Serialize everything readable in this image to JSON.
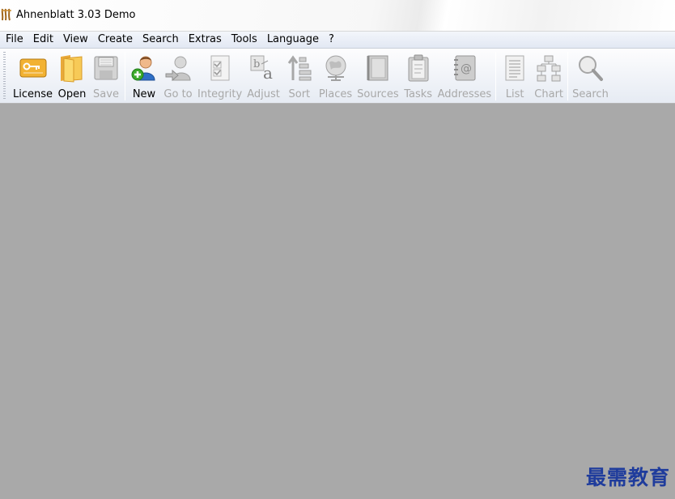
{
  "window": {
    "title": "Ahnenblatt 3.03 Demo"
  },
  "menu": {
    "items": [
      {
        "label": "File"
      },
      {
        "label": "Edit"
      },
      {
        "label": "View"
      },
      {
        "label": "Create"
      },
      {
        "label": "Search"
      },
      {
        "label": "Extras"
      },
      {
        "label": "Tools"
      },
      {
        "label": "Language"
      },
      {
        "label": "?"
      }
    ]
  },
  "toolbar": {
    "license": {
      "label": "License",
      "icon": "license-icon",
      "enabled": true
    },
    "open": {
      "label": "Open",
      "icon": "folder-icon",
      "enabled": true
    },
    "save": {
      "label": "Save",
      "icon": "floppy-icon",
      "enabled": false
    },
    "new": {
      "label": "New",
      "icon": "add-person-icon",
      "enabled": true
    },
    "goto": {
      "label": "Go to",
      "icon": "goto-person-icon",
      "enabled": false
    },
    "integrity": {
      "label": "Integrity",
      "icon": "checklist-icon",
      "enabled": false
    },
    "adjust": {
      "label": "Adjust",
      "icon": "text-case-icon",
      "enabled": false
    },
    "sort": {
      "label": "Sort",
      "icon": "sort-icon",
      "enabled": false
    },
    "places": {
      "label": "Places",
      "icon": "globe-icon",
      "enabled": false
    },
    "sources": {
      "label": "Sources",
      "icon": "book-icon",
      "enabled": false
    },
    "tasks": {
      "label": "Tasks",
      "icon": "clipboard-icon",
      "enabled": false
    },
    "addresses": {
      "label": "Addresses",
      "icon": "address-book-icon",
      "enabled": false
    },
    "list": {
      "label": "List",
      "icon": "list-icon",
      "enabled": false
    },
    "chart": {
      "label": "Chart",
      "icon": "tree-chart-icon",
      "enabled": false
    },
    "search": {
      "label": "Search",
      "icon": "magnifier-icon",
      "enabled": false
    }
  },
  "watermark": {
    "text": "最需教育"
  },
  "colors": {
    "workspace": "#a9a9a9",
    "disabled_text": "#a8a8a8",
    "watermark": "#1f3c9c"
  }
}
